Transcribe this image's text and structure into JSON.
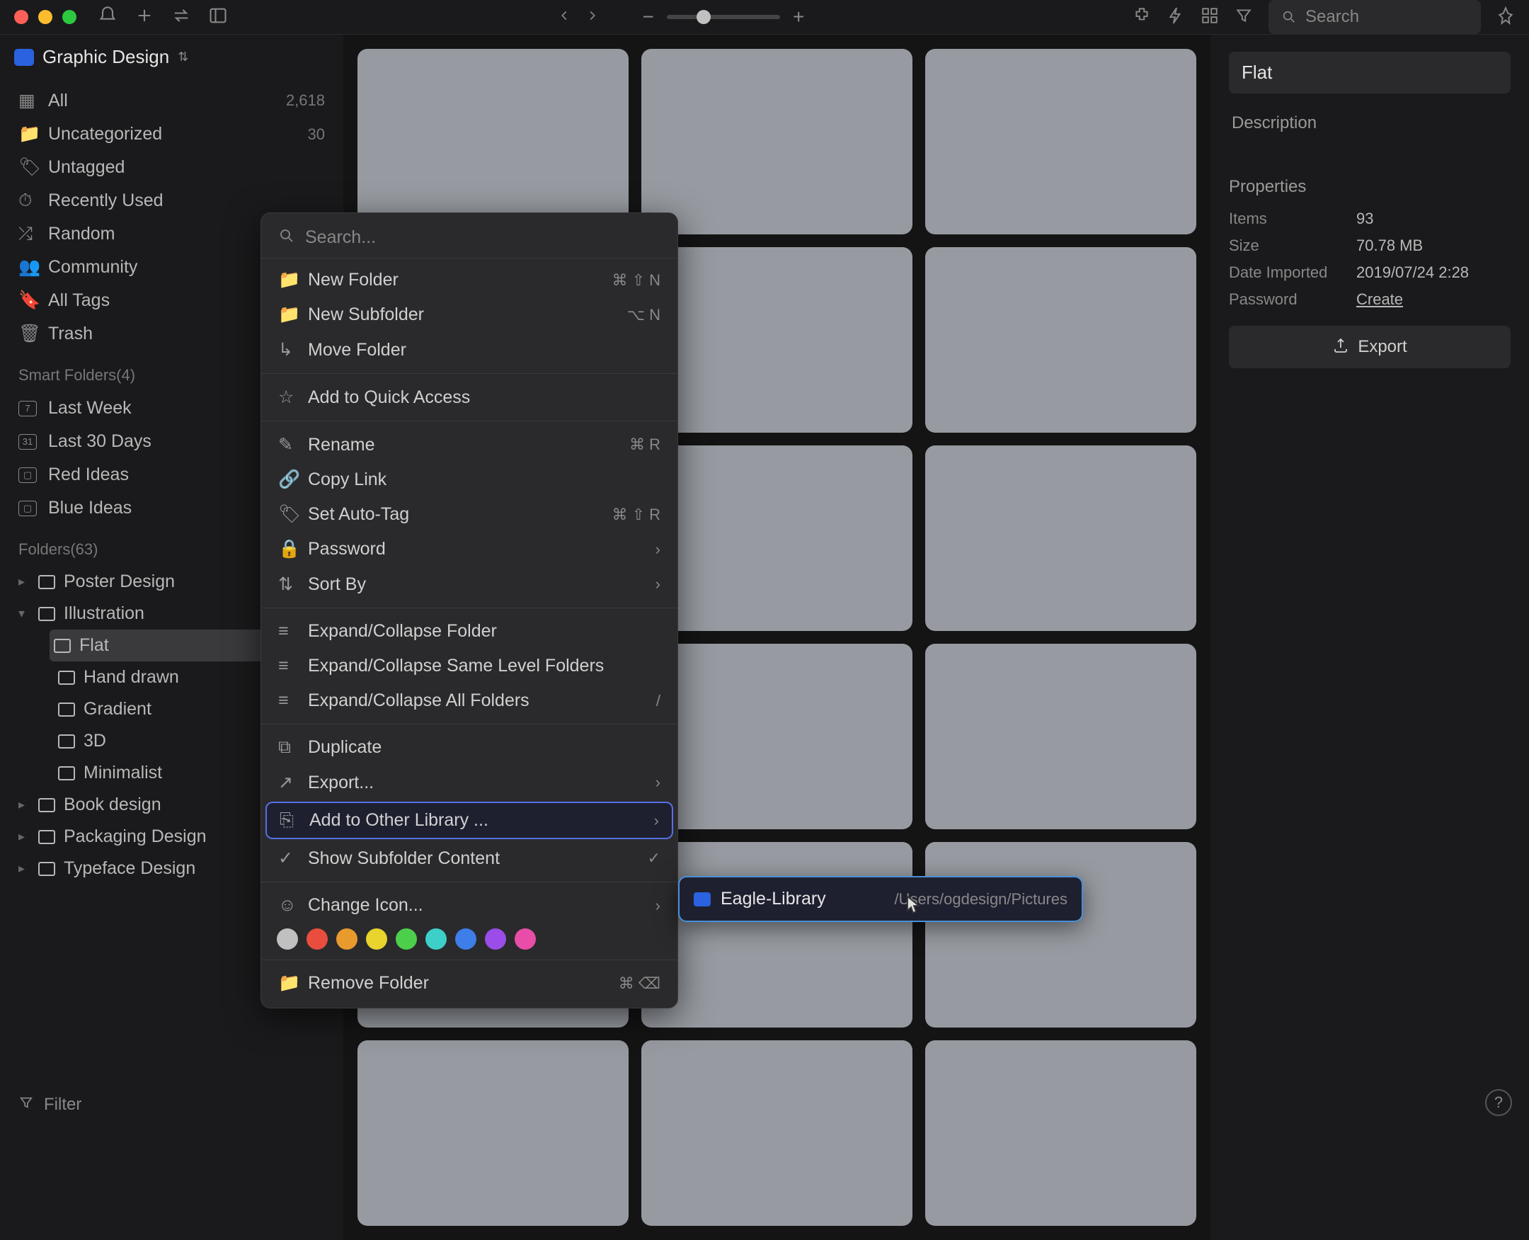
{
  "titlebar": {
    "search_placeholder": "Search"
  },
  "library": {
    "name": "Graphic Design"
  },
  "sidebar": {
    "items": [
      {
        "label": "All",
        "count": "2,618"
      },
      {
        "label": "Uncategorized",
        "count": "30"
      },
      {
        "label": "Untagged",
        "count": ""
      },
      {
        "label": "Recently Used",
        "count": ""
      },
      {
        "label": "Random",
        "count": ""
      },
      {
        "label": "Community",
        "count": ""
      },
      {
        "label": "All Tags",
        "count": ""
      },
      {
        "label": "Trash",
        "count": ""
      }
    ],
    "smart_header": "Smart Folders(4)",
    "smart": [
      {
        "label": "Last Week"
      },
      {
        "label": "Last 30 Days"
      },
      {
        "label": "Red Ideas"
      },
      {
        "label": "Blue Ideas"
      }
    ],
    "folders_header": "Folders(63)",
    "folders": [
      {
        "label": "Poster Design",
        "color": "red-f"
      },
      {
        "label": "Illustration",
        "color": "orange-f",
        "open": true,
        "children": [
          {
            "label": "Flat",
            "selected": true
          },
          {
            "label": "Hand drawn"
          },
          {
            "label": "Gradient"
          },
          {
            "label": "3D"
          },
          {
            "label": "Minimalist"
          }
        ]
      },
      {
        "label": "Book design",
        "color": "orange-f"
      },
      {
        "label": "Packaging Design",
        "color": "green-f"
      },
      {
        "label": "Typeface Design",
        "color": "green-f"
      }
    ],
    "filter": "Filter"
  },
  "context_menu": {
    "search_placeholder": "Search...",
    "items1": [
      {
        "label": "New Folder",
        "shortcut": "⌘ ⇧ N"
      },
      {
        "label": "New Subfolder",
        "shortcut": "⌥ N"
      },
      {
        "label": "Move Folder",
        "shortcut": ""
      }
    ],
    "quick_access": "Add to Quick Access",
    "items2": [
      {
        "label": "Rename",
        "shortcut": "⌘ R"
      },
      {
        "label": "Copy Link",
        "shortcut": ""
      },
      {
        "label": "Set Auto-Tag",
        "shortcut": "⌘ ⇧ R"
      },
      {
        "label": "Password",
        "shortcut": "›"
      },
      {
        "label": "Sort By",
        "shortcut": "›"
      }
    ],
    "items3": [
      {
        "label": "Expand/Collapse Folder"
      },
      {
        "label": "Expand/Collapse Same Level Folders"
      },
      {
        "label": "Expand/Collapse All Folders",
        "shortcut": "/"
      }
    ],
    "items4": [
      {
        "label": "Duplicate",
        "shortcut": ""
      },
      {
        "label": "Export...",
        "shortcut": "›"
      },
      {
        "label": "Add to Other Library ...",
        "shortcut": "›",
        "hl": true
      },
      {
        "label": "Show Subfolder Content",
        "shortcut": "✓"
      }
    ],
    "change_icon": "Change Icon...",
    "colors": [
      "#c0c0c0",
      "#e84d3d",
      "#e89a2d",
      "#e8d42d",
      "#4cd04c",
      "#3dd0c8",
      "#3d7ee8",
      "#9a4de8",
      "#e84da8"
    ],
    "remove": {
      "label": "Remove Folder",
      "shortcut": "⌘ ⌫"
    }
  },
  "submenu": {
    "name": "Eagle-Library",
    "path": "/Users/ogdesign/Pictures"
  },
  "inspector": {
    "title": "Flat",
    "description": "Description",
    "properties_label": "Properties",
    "props": [
      {
        "k": "Items",
        "v": "93"
      },
      {
        "k": "Size",
        "v": "70.78 MB"
      },
      {
        "k": "Date Imported",
        "v": "2019/07/24 2:28"
      },
      {
        "k": "Password",
        "v": "Create",
        "link": true
      }
    ],
    "export": "Export"
  }
}
